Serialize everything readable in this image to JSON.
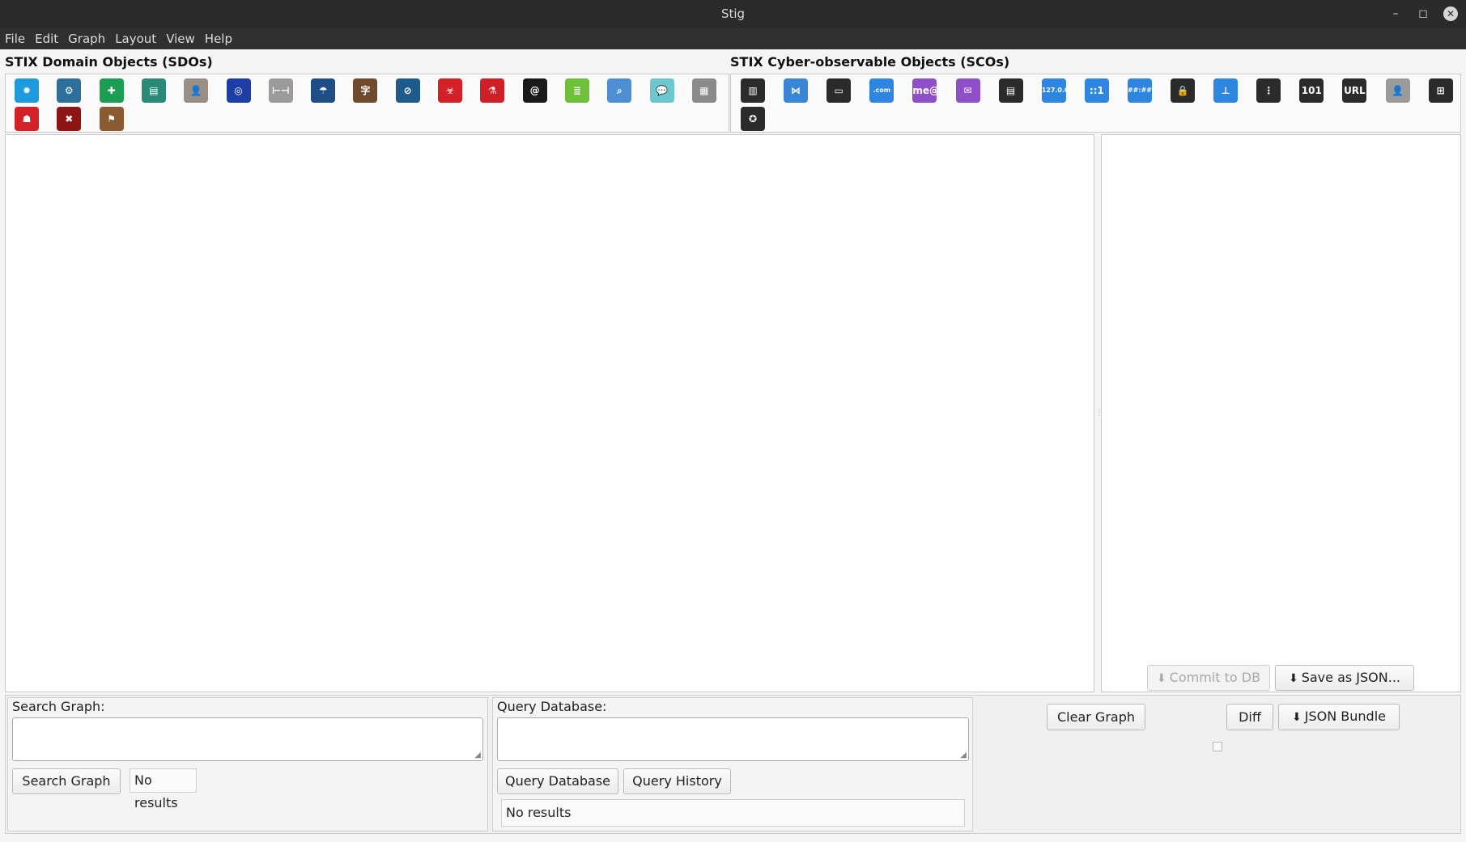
{
  "window": {
    "title": "Stig",
    "minimize": "–",
    "maximize": "◻",
    "close": "✕"
  },
  "menus": [
    "File",
    "Edit",
    "Graph",
    "Layout",
    "View",
    "Help"
  ],
  "sdo": {
    "heading": "STIX Domain Objects (SDOs)",
    "icons": [
      {
        "name": "attack-pattern-icon",
        "color": "#1e9bdc",
        "glyph": "✹"
      },
      {
        "name": "campaign-icon",
        "color": "#2c6f9b",
        "glyph": "⚙"
      },
      {
        "name": "course-of-action-icon",
        "color": "#1c9e52",
        "glyph": "✚"
      },
      {
        "name": "grouping-icon",
        "color": "#2a8a77",
        "glyph": "▤"
      },
      {
        "name": "identity-icon",
        "color": "#9a8f85",
        "glyph": "👤"
      },
      {
        "name": "indicator-icon",
        "color": "#1d3ea6",
        "glyph": "◎"
      },
      {
        "name": "infrastructure-icon",
        "color": "#9b9b9b",
        "glyph": "⊢⊣"
      },
      {
        "name": "intrusion-set-icon",
        "color": "#1f4e86",
        "glyph": "☂"
      },
      {
        "name": "language-content-icon",
        "color": "#704a2c",
        "glyph": "字"
      },
      {
        "name": "location-icon",
        "color": "#1f5b8a",
        "glyph": "⊘"
      },
      {
        "name": "malware-icon",
        "color": "#d42027",
        "glyph": "☣"
      },
      {
        "name": "malware-analysis-icon",
        "color": "#cf2027",
        "glyph": "⚗"
      },
      {
        "name": "note-icon",
        "color": "#1a1a1a",
        "glyph": "@"
      },
      {
        "name": "observed-data-icon",
        "color": "#6fbf3a",
        "glyph": "≣"
      },
      {
        "name": "opinion-icon",
        "color": "#4e8fd3",
        "glyph": "⌕"
      },
      {
        "name": "report-icon",
        "color": "#6cc7cf",
        "glyph": "💬"
      },
      {
        "name": "threat-actor-icon",
        "color": "#8a8a8a",
        "glyph": "▦"
      },
      {
        "name": "tool-icon",
        "color": "#d42027",
        "glyph": "☗"
      },
      {
        "name": "vulnerability-icon",
        "color": "#8e1515",
        "glyph": "✖"
      },
      {
        "name": "sighting-icon",
        "color": "#8a5a30",
        "glyph": "⚑"
      }
    ]
  },
  "sco": {
    "heading": "STIX Cyber-observable Objects (SCOs)",
    "icons": [
      {
        "name": "artifact-icon",
        "color": "#2b2b2b",
        "glyph": "▥"
      },
      {
        "name": "autonomous-system-icon",
        "color": "#3a86d6",
        "glyph": "⋈"
      },
      {
        "name": "directory-icon",
        "color": "#2b2b2b",
        "glyph": "▭"
      },
      {
        "name": "domain-name-icon",
        "color": "#2f86e0",
        "glyph": ".com"
      },
      {
        "name": "email-addr-icon",
        "color": "#8e4fc7",
        "glyph": "me@"
      },
      {
        "name": "email-message-icon",
        "color": "#8e4fc7",
        "glyph": "✉"
      },
      {
        "name": "file-icon",
        "color": "#2b2b2b",
        "glyph": "▤"
      },
      {
        "name": "ipv4-addr-icon",
        "color": "#2f86e0",
        "glyph": "127.0.0.1"
      },
      {
        "name": "ipv6-addr-icon",
        "color": "#2f86e0",
        "glyph": "::1"
      },
      {
        "name": "mac-addr-icon",
        "color": "#2f86e0",
        "glyph": "##:##"
      },
      {
        "name": "mutex-icon",
        "color": "#2b2b2b",
        "glyph": "🔒"
      },
      {
        "name": "network-traffic-icon",
        "color": "#2f86e0",
        "glyph": "⊥"
      },
      {
        "name": "process-icon",
        "color": "#2b2b2b",
        "glyph": "⋮"
      },
      {
        "name": "software-icon",
        "color": "#2b2b2b",
        "glyph": "101"
      },
      {
        "name": "url-icon",
        "color": "#2b2b2b",
        "glyph": "URL"
      },
      {
        "name": "user-account-icon",
        "color": "#9a9a9a",
        "glyph": "👤"
      },
      {
        "name": "windows-registry-key-icon",
        "color": "#2b2b2b",
        "glyph": "⊞"
      },
      {
        "name": "x509-certificate-icon",
        "color": "#2b2b2b",
        "glyph": "✪"
      }
    ]
  },
  "editor": {
    "commit_label": "Commit to DB",
    "save_json_label": "Save as JSON..."
  },
  "search": {
    "label": "Search Graph:",
    "value": "",
    "button": "Search Graph",
    "results": "No results"
  },
  "query": {
    "label": "Query Database:",
    "value": "",
    "button": "Query Database",
    "history_button": "Query History",
    "results": "No results"
  },
  "actions": {
    "clear_graph": "Clear Graph",
    "diff": "Diff",
    "json_bundle": "JSON Bundle"
  }
}
